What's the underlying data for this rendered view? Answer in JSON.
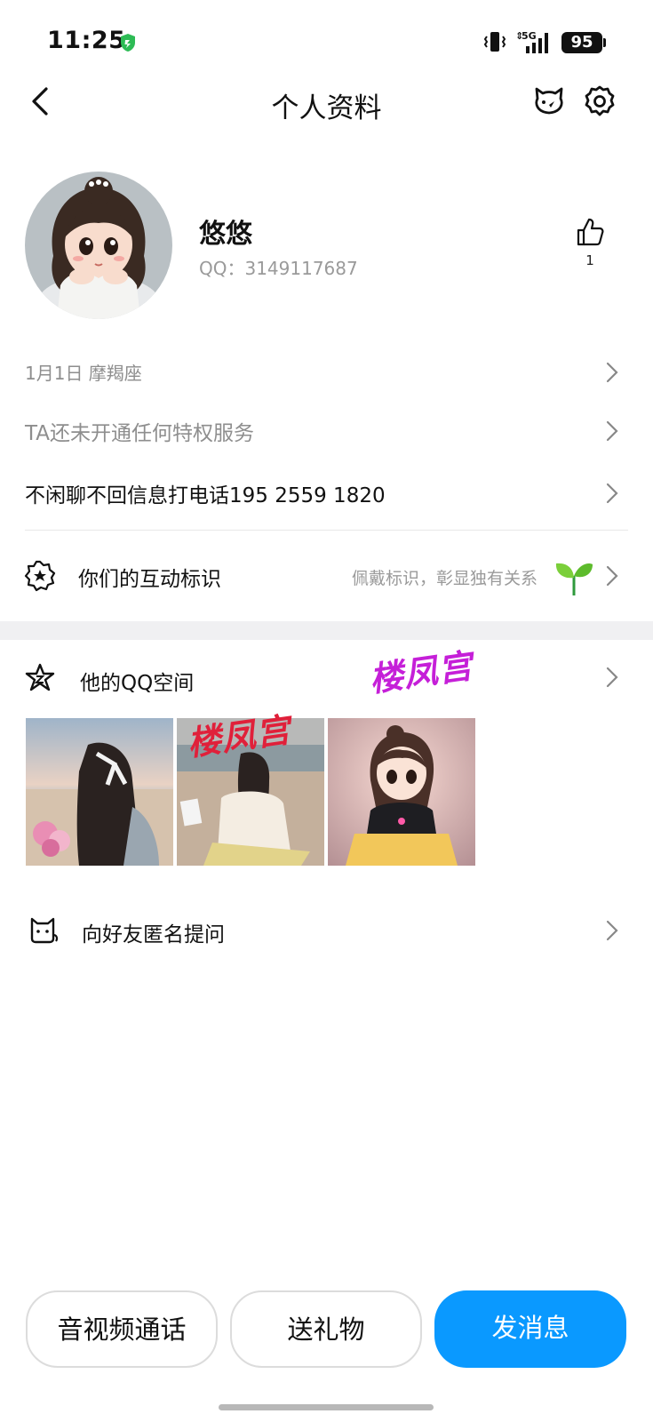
{
  "status_bar": {
    "time": "11:25",
    "network": "5G",
    "battery": "95"
  },
  "nav": {
    "title": "个人资料"
  },
  "profile": {
    "nickname": "悠悠",
    "qq_line": "QQ：3149117687",
    "likes": "1"
  },
  "rows": {
    "birthday_sign": "1月1日   摩羯座",
    "privilege": "TA还未开通任何特权服务",
    "signature": "不闲聊不回信息打电话195 2559 1820"
  },
  "interaction": {
    "label": "你们的互动标识",
    "hint": "佩戴标识，彰显独有关系"
  },
  "qzone": {
    "label": "他的QQ空间",
    "watermarks": [
      "楼凤宫",
      "楼凤宫"
    ]
  },
  "ask": {
    "label": "向好友匿名提问"
  },
  "actions": {
    "call": "音视频通话",
    "gift": "送礼物",
    "message": "发消息"
  },
  "colors": {
    "primary_button": "#0a99ff",
    "text_secondary": "#9a9a9a",
    "watermark_red": "#e0203a",
    "watermark_purple": "#c51fd8"
  }
}
